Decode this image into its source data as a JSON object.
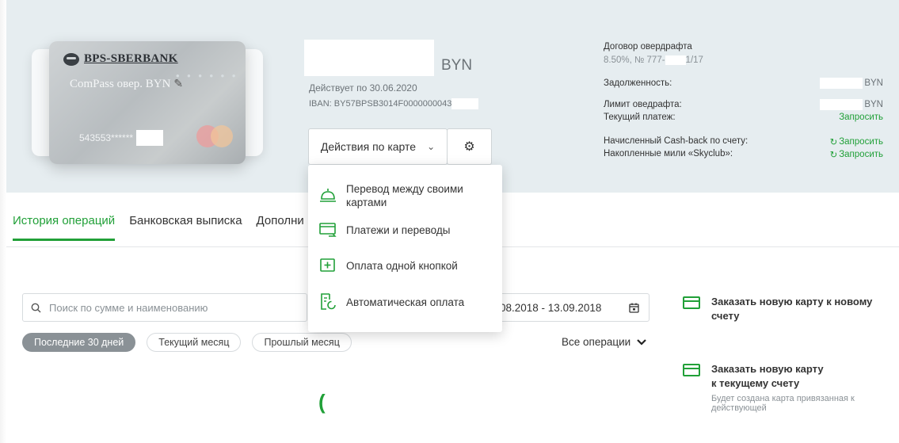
{
  "card": {
    "bank_name": "BPS-SBERBANK",
    "card_name": "ComPass овер. BYN",
    "edit_icon": "pencil-icon",
    "number_prefix": "543553******",
    "payment_system": "mastercard"
  },
  "account": {
    "currency": "BYN",
    "valid_until": "Действует по 30.06.2020",
    "iban": "IBAN: BY57BPSB3014F0000000043"
  },
  "actions": {
    "button_label": "Действия по карте",
    "settings_icon": "gear-icon",
    "menu": [
      {
        "label": "Перевод между своими картами",
        "icon": "transfer-bell-icon"
      },
      {
        "label": "Платежи и переводы",
        "icon": "payments-icon"
      },
      {
        "label": "Оплата одной кнопкой",
        "icon": "plus-box-icon"
      },
      {
        "label": "Автоматическая оплата",
        "icon": "auto-pay-icon"
      }
    ]
  },
  "overdraft": {
    "title": "Договор овердрафта",
    "subtitle_prefix": "8.50%, № 777-",
    "subtitle_suffix": "1/17",
    "debt_label": "Задолженность:",
    "debt_currency": "BYN",
    "limit_label": "Лимит оведрафта:",
    "limit_currency": "BYN",
    "payment_label": "Текущий платеж:",
    "payment_action": "Запросить",
    "cashback_label": "Начисленный Cash-back по счету:",
    "cashback_action": "Запросить",
    "miles_label": "Накопленные мили «Skyclub»:",
    "miles_action": "Запросить"
  },
  "tabs": [
    {
      "label": "История операций",
      "active": true
    },
    {
      "label": "Банковская выписка",
      "active": false
    },
    {
      "label": "Дополни",
      "active": false
    }
  ],
  "search": {
    "placeholder": "Поиск по сумме и наименованию"
  },
  "date_range": "08.2018 - 13.09.2018",
  "chips": [
    {
      "label": "Последние 30 дней",
      "active": true
    },
    {
      "label": "Текущий месяц",
      "active": false
    },
    {
      "label": "Прошлый месяц",
      "active": false
    }
  ],
  "all_operations": "Все операции",
  "right_actions": [
    {
      "title": "Заказать новую карту к новому счету",
      "subtitle": ""
    },
    {
      "title_line1": "Заказать новую карту",
      "title_line2": "к текущему счету",
      "subtitle": "Будет создана карта привязанная к действующей"
    }
  ],
  "colors": {
    "accent": "#21a038",
    "header_bg": "#e6edf0"
  }
}
